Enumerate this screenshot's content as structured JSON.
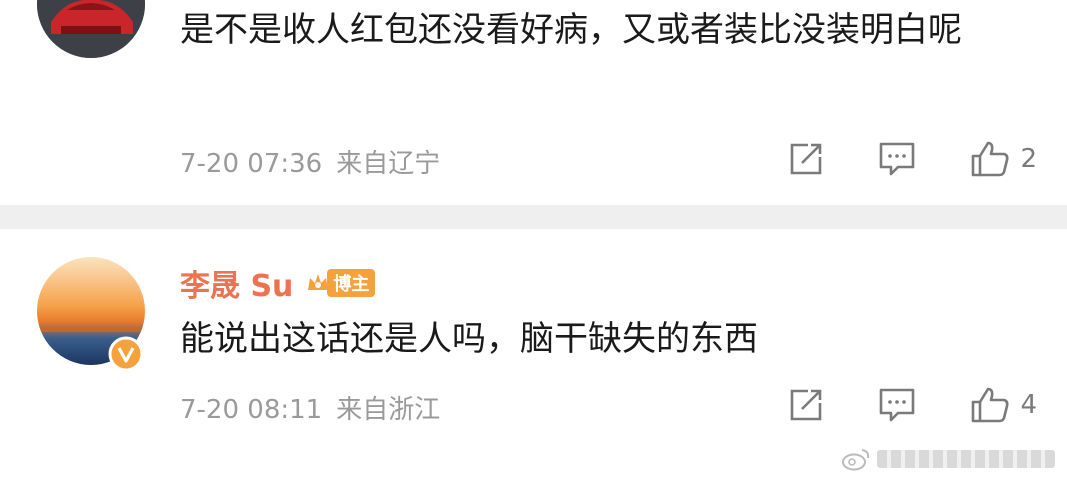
{
  "comments": [
    {
      "text": "是不是收人红包还没看好病，又或者装比没装明白呢",
      "time": "7-20 07:36",
      "location": "来自辽宁",
      "likes": "2",
      "avatar_icon": "red-car-avatar"
    },
    {
      "username": "李晟 Su",
      "badge": "博主",
      "text": "能说出这话还是人吗，脑干缺失的东西",
      "time": "7-20 08:11",
      "location": "来自浙江",
      "likes": "4",
      "avatar_icon": "sunset-avatar",
      "verified_icon": "verified-v-icon"
    }
  ],
  "colors": {
    "username": "#eb7350",
    "badge": "#f6a23c",
    "meta": "#9a9a9a",
    "separator": "#efefef"
  },
  "icons": [
    "repost-icon",
    "comment-icon",
    "like-icon",
    "weibo-logo-icon"
  ]
}
